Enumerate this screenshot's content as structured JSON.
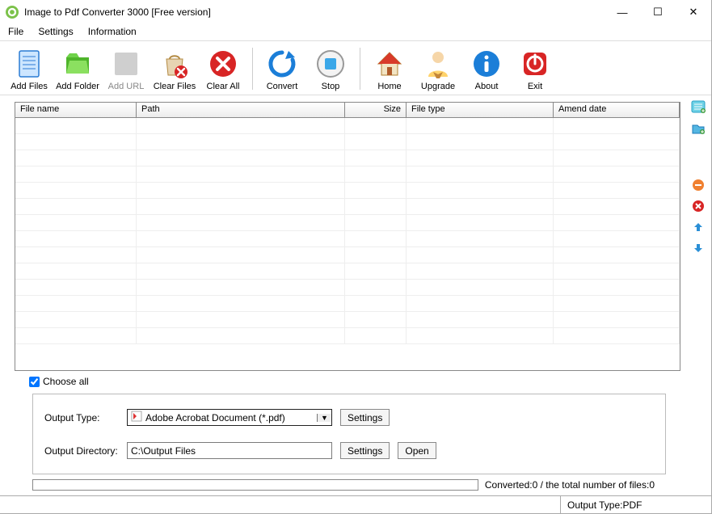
{
  "window": {
    "title": "Image to Pdf Converter 3000 [Free version]"
  },
  "menu": {
    "file": "File",
    "settings": "Settings",
    "information": "Information"
  },
  "toolbar": {
    "add_files": "Add Files",
    "add_folder": "Add Folder",
    "add_url": "Add URL",
    "clear_files": "Clear Files",
    "clear_all": "Clear All",
    "convert": "Convert",
    "stop": "Stop",
    "home": "Home",
    "upgrade": "Upgrade",
    "about": "About",
    "exit": "Exit"
  },
  "grid": {
    "cols": {
      "filename": "File name",
      "path": "Path",
      "size": "Size",
      "filetype": "File type",
      "amend": "Amend date"
    },
    "rows": []
  },
  "choose_all": {
    "label": "Choose all",
    "checked": true
  },
  "output": {
    "type_label": "Output Type:",
    "type_value": "Adobe Acrobat Document (*.pdf)",
    "type_settings_btn": "Settings",
    "dir_label": "Output Directory:",
    "dir_value": "C:\\Output Files",
    "dir_settings_btn": "Settings",
    "open_btn": "Open"
  },
  "status": {
    "converted_text": "Converted:0  /  the total number of files:0",
    "output_type_label": "Output Type: ",
    "output_type_value": "PDF"
  },
  "colors": {
    "accent_blue": "#1b7ed8",
    "accent_red": "#d82525",
    "accent_green": "#56b52e"
  }
}
